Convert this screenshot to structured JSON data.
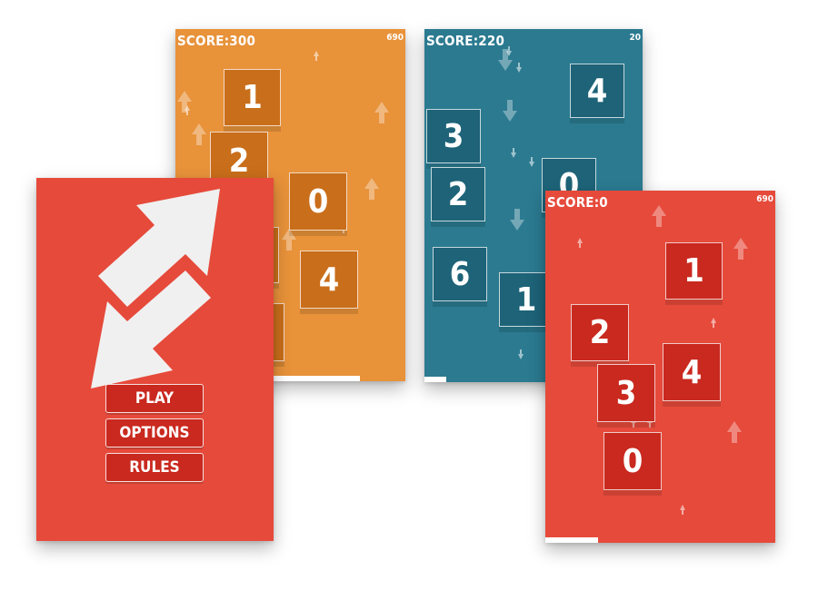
{
  "colors": {
    "orange_bg": "#e8923a",
    "orange_tile": "#c96e1a",
    "teal_bg": "#2b7a90",
    "teal_tile": "#1e6378",
    "red_bg": "#e64a3b",
    "red_tile": "#c9291f",
    "logo_white": "#f0f0f0"
  },
  "menu_screen": {
    "logo_icon": "swap-arrows-icon",
    "buttons": {
      "play": "PLAY",
      "options": "OPTIONS",
      "rules": "RULES"
    }
  },
  "orange_screen": {
    "score_label": "SCORE:300",
    "best": "690",
    "tiles": [
      "1",
      "2",
      "0",
      "4"
    ],
    "progress": 0.66
  },
  "teal_screen": {
    "score_label": "SCORE:220",
    "best": "20",
    "tiles": [
      "4",
      "3",
      "2",
      "0",
      "6",
      "1"
    ],
    "progress": 0.1
  },
  "red_screen": {
    "score_label": "SCORE:0",
    "best": "690",
    "tiles": [
      "1",
      "2",
      "4",
      "3",
      "0"
    ],
    "progress": 0.23
  }
}
